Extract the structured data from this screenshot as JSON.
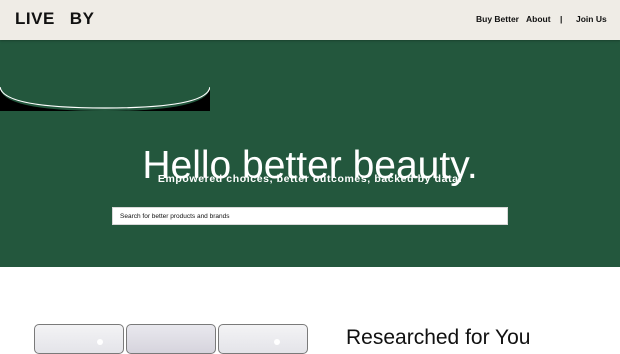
{
  "brand": {
    "logo_word1": "LIVE",
    "logo_word2": "BY"
  },
  "nav": {
    "buy_better": "Buy Better",
    "about": "About",
    "separator": "|",
    "join_us": "Join Us"
  },
  "hero": {
    "title": "Hello better beauty.",
    "subtitle": "Empowered choices, better outcomes, backed by data.",
    "background_color": "#23573d"
  },
  "search": {
    "placeholder": "Search for better products and brands",
    "value": ""
  },
  "researched": {
    "title": "Researched for You"
  },
  "colors": {
    "header_bg": "#efece6",
    "hero_green": "#23573d",
    "text_dark": "#111111"
  }
}
